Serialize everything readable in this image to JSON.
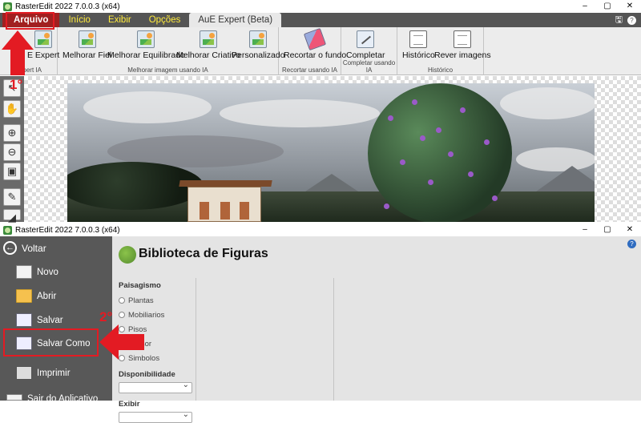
{
  "app": {
    "title": "RasterEdit 2022 7.0.0.3 (x64)"
  },
  "window_controls": {
    "minimize": "–",
    "maximize": "▢",
    "close": "✕"
  },
  "menu": {
    "items": [
      "Arquivo",
      "Início",
      "Exibir",
      "Opções",
      "AuE Expert (Beta)"
    ],
    "right_icons": [
      "save-icon",
      "help-icon"
    ]
  },
  "ribbon": {
    "groups": [
      {
        "label": "Expert IA",
        "buttons": [
          "E Expert"
        ]
      },
      {
        "label": "Melhorar imagem usando IA",
        "buttons": [
          "Melhorar Fiel",
          "Melhorar Equilibrado",
          "Melhorar Criativo",
          "Personalizado"
        ]
      },
      {
        "label": "Recortar usando IA",
        "buttons": [
          "Recortar o fundo"
        ]
      },
      {
        "label": "Completar usando IA",
        "buttons": [
          "Completar"
        ]
      },
      {
        "label": "Histórico",
        "buttons": [
          "Histórico",
          "Rever imagens"
        ]
      }
    ]
  },
  "annotations": {
    "step1": "1°",
    "step2": "2°"
  },
  "backstage": {
    "title": "RasterEdit 2022 7.0.0.3 (x64)",
    "back_label": "Voltar",
    "items": [
      "Novo",
      "Abrir",
      "Salvar",
      "Salvar Como",
      "Imprimir"
    ],
    "cutoff_item": "Sair do Aplicativo"
  },
  "library": {
    "title": "Biblioteca de Figuras",
    "category_head": "Paisagismo",
    "categories": [
      "Plantas",
      "Mobiliarios",
      "Pisos",
      "Divisor",
      "Simbolos"
    ],
    "availability_label": "Disponibilidade",
    "show_label": "Exibir"
  },
  "colors": {
    "accent_red": "#e31b23",
    "menu_bg": "#555555",
    "menu_text": "#ffeb3b",
    "backstage_bg": "#585858"
  }
}
